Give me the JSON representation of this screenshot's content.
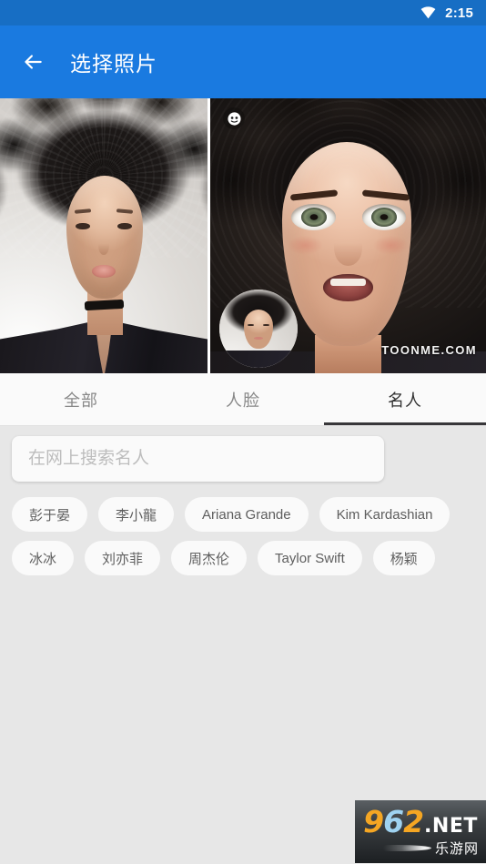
{
  "status_bar": {
    "time": "2:15",
    "wifi_icon": "wifi-icon",
    "background_color": "#176ec4"
  },
  "app_bar": {
    "back_icon": "back-arrow-icon",
    "title": "选择照片",
    "background_color": "#1a7ae0",
    "text_color": "#ffffff"
  },
  "photos": {
    "left": {
      "name": "original-photo",
      "description": "woman with curly black hair portrait"
    },
    "right": {
      "name": "toon-photo",
      "badge_icon": "face-emoji-icon",
      "watermark": "TOONME.COM",
      "inset_thumbnail": "original-photo-thumbnail"
    }
  },
  "tabs": [
    {
      "label": "全部",
      "active": false
    },
    {
      "label": "人脸",
      "active": false
    },
    {
      "label": "名人",
      "active": true
    }
  ],
  "tab_indicator_color": "#38373a",
  "search": {
    "placeholder": "在网上搜索名人",
    "value": ""
  },
  "chips": [
    "彭于晏",
    "李小龍",
    "Ariana Grande",
    "Kim Kardashian",
    "冰冰",
    "刘亦菲",
    "周杰伦",
    "Taylor Swift",
    "杨颖"
  ],
  "site_watermark": {
    "digits_prefix": "9",
    "digit_middle": "6",
    "digits_suffix": "2",
    "net": ".NET",
    "chinese": "乐游网"
  }
}
